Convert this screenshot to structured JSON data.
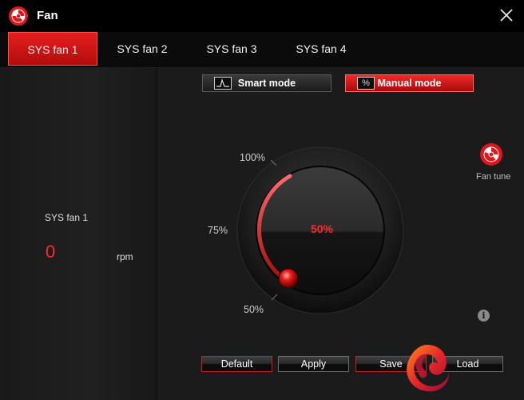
{
  "app": {
    "title": "Fan",
    "logo_icon": "msi-dragon-logo-icon",
    "close_icon": "close-icon"
  },
  "tabs": [
    {
      "label": "SYS fan 1",
      "active": true
    },
    {
      "label": "SYS fan 2",
      "active": false
    },
    {
      "label": "SYS fan 3",
      "active": false
    },
    {
      "label": "SYS fan 4",
      "active": false
    }
  ],
  "status": {
    "fan_name": "SYS fan 1",
    "rpm_value": "0",
    "rpm_unit": "rpm"
  },
  "modes": {
    "smart": {
      "label": "Smart mode",
      "icon": "curve-graph-icon",
      "active": false
    },
    "manual": {
      "label": "Manual mode",
      "icon": "percent-icon",
      "icon_glyph": "%",
      "active": true
    }
  },
  "dial": {
    "value_label": "50%",
    "value_fraction": 0.0,
    "tick_labels": {
      "top": "100%",
      "middle": "75%",
      "bottom": "50%"
    }
  },
  "fan_tune": {
    "label": "Fan tune",
    "icon": "fan-tune-icon"
  },
  "info": {
    "glyph": "i",
    "icon": "info-icon"
  },
  "buttons": {
    "default": "Default",
    "apply": "Apply",
    "save": "Save",
    "load": "Load"
  },
  "colors": {
    "accent": "#e31b1b",
    "value_red": "#ff2a2a",
    "background": "#151515"
  }
}
